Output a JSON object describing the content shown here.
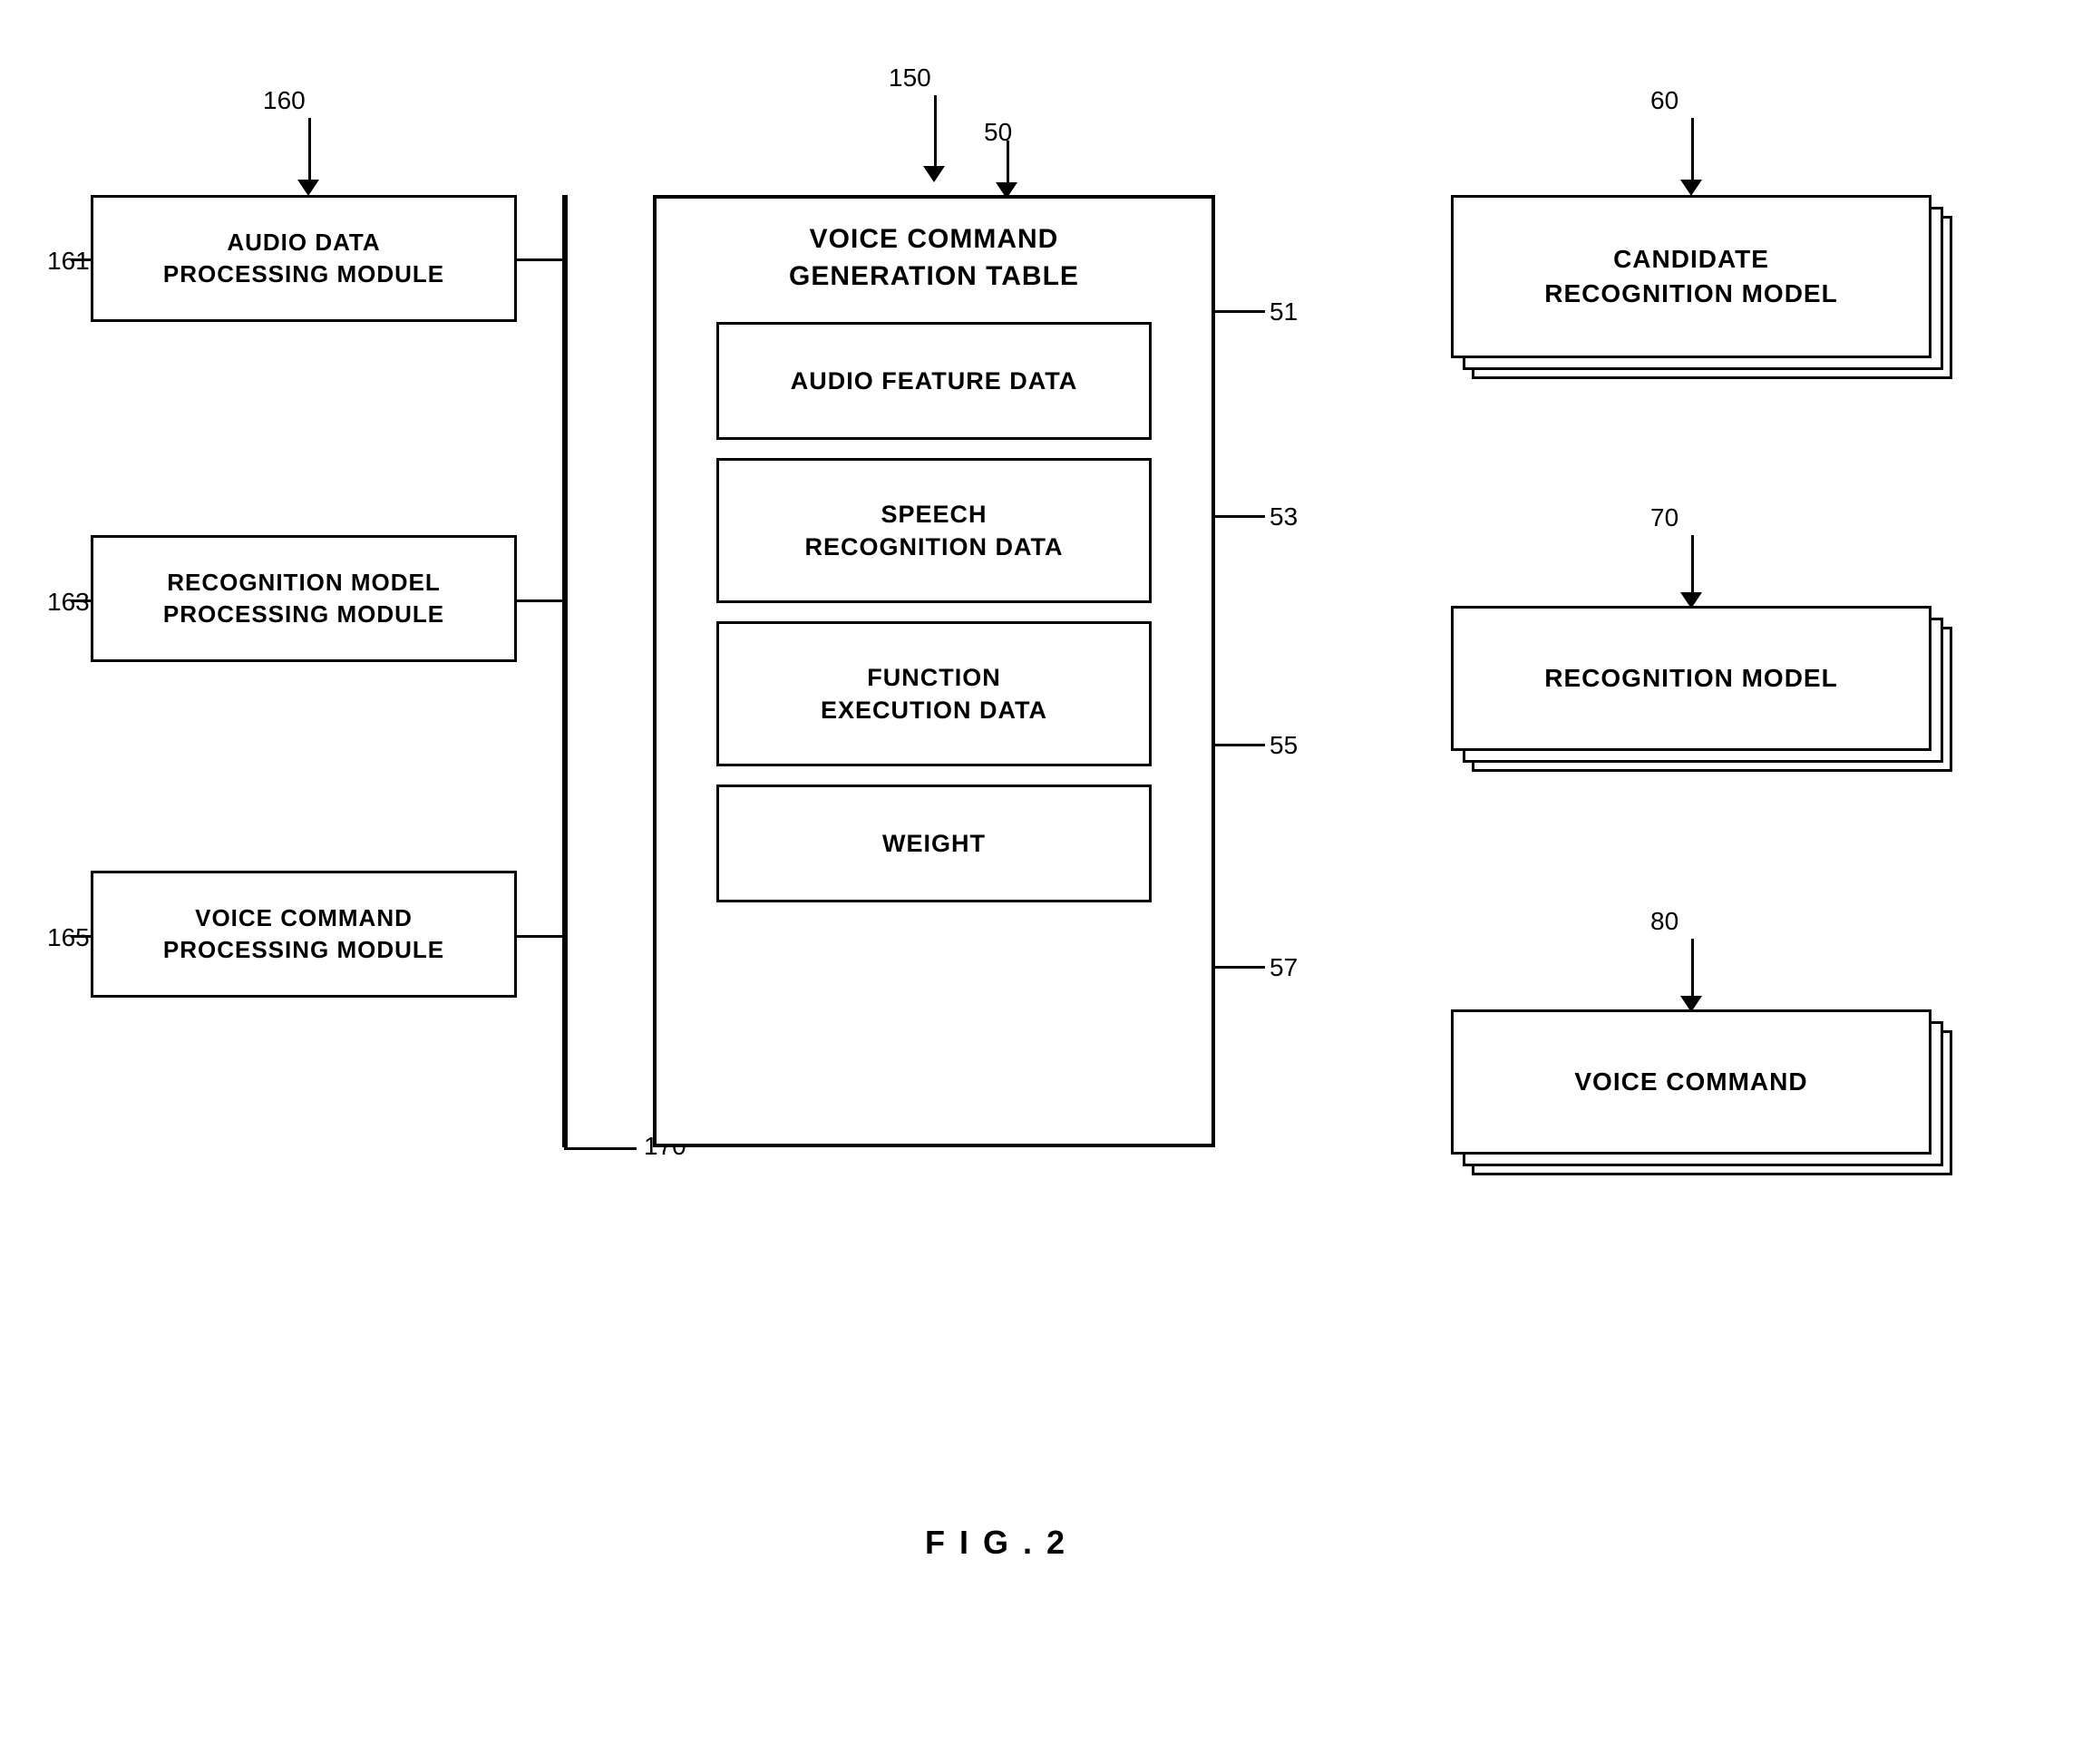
{
  "title": "FIG.2",
  "labels": {
    "ref_160": "160",
    "ref_150": "150",
    "ref_50": "50",
    "ref_60": "60",
    "ref_161": "161",
    "ref_163": "163",
    "ref_165": "165",
    "ref_51": "51",
    "ref_53": "53",
    "ref_55": "55",
    "ref_57": "57",
    "ref_70": "70",
    "ref_80": "80",
    "ref_170": "170"
  },
  "boxes": {
    "audio_data_processing": "AUDIO DATA\nPROCESSING MODULE",
    "recognition_model_processing": "RECOGNITION MODEL\nPROCESSING MODULE",
    "voice_command_processing": "VOICE COMMAND\nPROCESSING MODULE",
    "voice_command_gen_table": "VOICE COMMAND\nGENERATION TABLE",
    "audio_feature_data": "AUDIO FEATURE DATA",
    "speech_recognition_data": "SPEECH\nRECOGNITION DATA",
    "function_execution_data": "FUNCTION\nEXECUTION DATA",
    "weight": "WEIGHT",
    "candidate_recognition_model": "CANDIDATE\nRECOGNITION MODEL",
    "recognition_model": "RECOGNITION MODEL",
    "voice_command": "VOICE COMMAND"
  },
  "fig_label": "F I G . 2"
}
